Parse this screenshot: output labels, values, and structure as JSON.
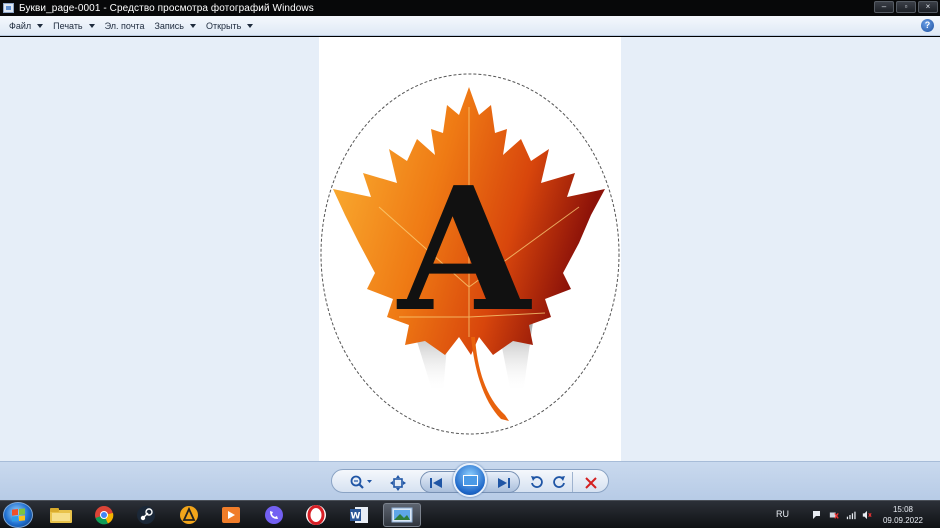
{
  "window": {
    "title": "Букви_page-0001 - Средство просмотра фотографий Windows",
    "controls": [
      "–",
      "▫",
      "×"
    ]
  },
  "menu": {
    "items": [
      {
        "label": "Файл",
        "has_arrow": true
      },
      {
        "label": "Печать",
        "has_arrow": true
      },
      {
        "label": "Эл. почта",
        "has_arrow": false
      },
      {
        "label": "Запись",
        "has_arrow": true
      },
      {
        "label": "Открыть",
        "has_arrow": true
      }
    ],
    "help_label": "?"
  },
  "photo": {
    "letter": "A",
    "leaf_colors": [
      "#f7a21b",
      "#e8620d",
      "#8c1209"
    ]
  },
  "controls": {
    "zoom_icon": "magnifier-icon",
    "fit_icon": "actual-size-icon",
    "prev_icon": "previous-icon",
    "slideshow_icon": "slideshow-icon",
    "next_icon": "next-icon",
    "rotate_left_icon": "rotate-ccw-icon",
    "rotate_right_icon": "rotate-cw-icon",
    "delete_icon": "delete-icon",
    "accent": "#1f55a5",
    "delete_color": "#d42020"
  },
  "taskbar": {
    "apps": [
      "explorer",
      "chrome",
      "steam",
      "aimp",
      "media-player",
      "viber",
      "opera",
      "word",
      "photo-viewer"
    ],
    "language": "RU",
    "time": "15:08",
    "date": "09.09.2022"
  }
}
